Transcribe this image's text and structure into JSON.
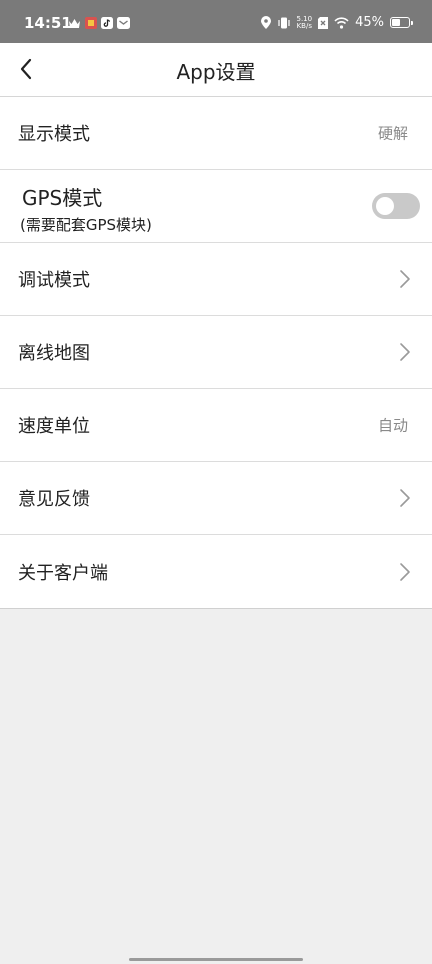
{
  "status_bar": {
    "time": "14:51",
    "net_speed_value": "5.10",
    "net_speed_unit": "KB/s",
    "battery_percent": "45%",
    "battery_level": 0.45
  },
  "header": {
    "title": "App设置"
  },
  "settings": {
    "display_mode": {
      "label": "显示模式",
      "value": "硬解"
    },
    "gps_mode": {
      "label": "GPS模式",
      "sublabel": "(需要配套GPS模块)",
      "enabled": false
    },
    "debug_mode": {
      "label": "调试模式"
    },
    "offline_map": {
      "label": "离线地图"
    },
    "speed_unit": {
      "label": "速度单位",
      "value": "自动"
    },
    "feedback": {
      "label": "意见反馈"
    },
    "about": {
      "label": "关于客户端"
    }
  },
  "colors": {
    "status_bar": "#7a7a7a",
    "background": "#efefef",
    "toggle_off": "#c9c9c9"
  }
}
